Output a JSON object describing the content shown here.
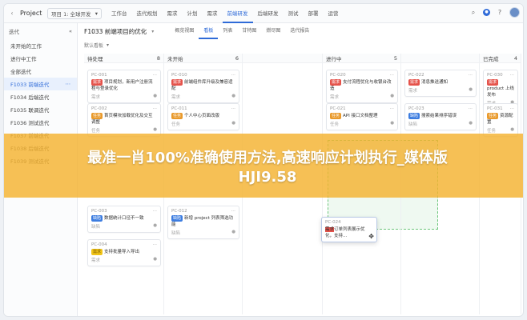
{
  "topbar": {
    "project_label": "Project",
    "selector": "项目 1: 全球开发",
    "nav": [
      "工作台",
      "迭代规划",
      "需求",
      "计划",
      "需求",
      "前端研发",
      "后端研发",
      "测试",
      "部署",
      "运营"
    ],
    "active_nav": 5
  },
  "sidebar": {
    "header": "迭代",
    "items": [
      {
        "label": "未开始的工作"
      },
      {
        "label": "进行中工作"
      },
      {
        "label": "全部迭代"
      },
      {
        "label": "F1033 前端迭代",
        "active": true
      },
      {
        "label": "F1034 后端迭代"
      },
      {
        "label": "F1035 联调迭代"
      },
      {
        "label": "F1036 测试迭代"
      },
      {
        "label": "F1037 前端迭代"
      },
      {
        "label": "F1038 后端迭代"
      },
      {
        "label": "F1039 测试迭代"
      }
    ]
  },
  "main": {
    "title": "F1033 前端项目的优化",
    "tabs": [
      "概览视图",
      "看板",
      "列表",
      "甘特图",
      "燃尽图",
      "迭代报告"
    ],
    "active_tab": 1,
    "sub": "默认看板"
  },
  "columns": [
    {
      "name": "待处理",
      "count": "8"
    },
    {
      "name": "未开始",
      "count": "6"
    },
    {
      "name": "",
      "count": ""
    },
    {
      "name": "进行中",
      "count": "5"
    },
    {
      "name": "",
      "count": ""
    },
    {
      "name": "已完成",
      "count": "4"
    }
  ],
  "cards": [
    {
      "col": 0,
      "row": 0,
      "id": "PC-001",
      "tag": "red",
      "tag_text": "需求",
      "text": "项目规划，新用户注册流程与登录优化",
      "meta": "需求"
    },
    {
      "col": 0,
      "row": 1,
      "id": "PC-002",
      "tag": "orange",
      "tag_text": "任务",
      "text": "首页模块加载优化及交互调整",
      "meta": "任务"
    },
    {
      "col": 0,
      "row": 2,
      "id": "PC-003",
      "tag": "blue",
      "tag_text": "缺陷",
      "text": "数据统计口径不一致",
      "meta": "缺陷"
    },
    {
      "col": 0,
      "row": 3,
      "id": "PC-004",
      "tag": "yellow",
      "tag_text": "需求",
      "text": "支持批量导入导出",
      "meta": "需求"
    },
    {
      "col": 1,
      "row": 0,
      "id": "PC-010",
      "tag": "red",
      "tag_text": "需求",
      "text": "前端组件库升级及兼容适配",
      "meta": "需求"
    },
    {
      "col": 1,
      "row": 1,
      "id": "PC-011",
      "tag": "orange",
      "tag_text": "任务",
      "text": "个人中心页面改版",
      "meta": "任务"
    },
    {
      "col": 1,
      "row": 2,
      "id": "PC-012",
      "tag": "blue",
      "tag_text": "缺陷",
      "text": "新增 project 列表筛选功能",
      "meta": "缺陷"
    },
    {
      "col": 3,
      "row": 0,
      "id": "PC-020",
      "tag": "red",
      "tag_text": "需求",
      "text": "支付流程优化与收银台改造",
      "meta": "需求"
    },
    {
      "col": 3,
      "row": 1,
      "id": "PC-021",
      "tag": "orange",
      "tag_text": "任务",
      "text": "API 接口文档整理",
      "meta": "任务"
    },
    {
      "col": 4,
      "row": 0,
      "id": "PC-022",
      "tag": "red",
      "tag_text": "需求",
      "text": "消息推送通知",
      "meta": "需求"
    },
    {
      "col": 4,
      "row": 1,
      "id": "PC-023",
      "tag": "blue",
      "tag_text": "缺陷",
      "text": "搜索结果排序错误",
      "meta": "缺陷"
    },
    {
      "col": 5,
      "row": 0,
      "id": "PC-030",
      "tag": "red",
      "tag_text": "需求",
      "text": "product 上线发布",
      "meta": "需求"
    },
    {
      "col": 5,
      "row": 1,
      "id": "PC-031",
      "tag": "orange",
      "tag_text": "任务",
      "text": "资源配置",
      "meta": "任务"
    }
  ],
  "drag_card": {
    "id": "PC-024",
    "tag_text": "需求",
    "text": "订单列表展示优化，支持..."
  },
  "overlay": {
    "line1": "最准一肖100%准确使用方法,高速响应计划执行_媒体版",
    "line2": "HJI9.58"
  }
}
